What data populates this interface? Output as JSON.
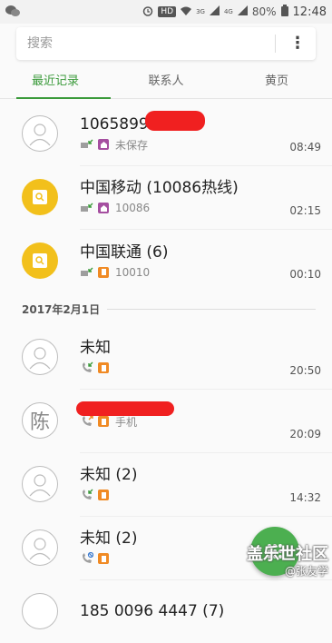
{
  "status": {
    "battery": "80%",
    "time": "12:48",
    "hd": "HD",
    "net1": "3G",
    "net2": "4G"
  },
  "search": {
    "placeholder": "搜索"
  },
  "tabs": [
    {
      "label": "最近记录"
    },
    {
      "label": "联系人"
    },
    {
      "label": "黄页"
    }
  ],
  "date_header": "2017年2月1日",
  "calls_today": [
    {
      "name": "1065899",
      "sub": "未保存",
      "time": "08:49"
    },
    {
      "name": "中国移动 (10086热线)",
      "sub": "10086",
      "time": "02:15"
    },
    {
      "name": "中国联通 (6)",
      "sub": "10010",
      "time": "00:10"
    }
  ],
  "calls_earlier": [
    {
      "name": "未知",
      "sub": "",
      "time": "20:50"
    },
    {
      "avatar": "陈",
      "name": "",
      "sub": "手机",
      "time": "20:09"
    },
    {
      "name": "未知 (2)",
      "sub": "",
      "time": "14:32"
    },
    {
      "name": "未知 (2)",
      "sub": "",
      "time": ""
    },
    {
      "name": "185 0096 4447 (7)",
      "sub": "",
      "time": ""
    }
  ],
  "watermark": {
    "line1": "盖乐世社区",
    "line2": "@张友学"
  },
  "colors": {
    "accent": "#3a9a3a",
    "yellow": "#f2c01b",
    "purple_sim": "#a54fa0",
    "orange_sim": "#f08a24",
    "fab": "#4caf50"
  }
}
